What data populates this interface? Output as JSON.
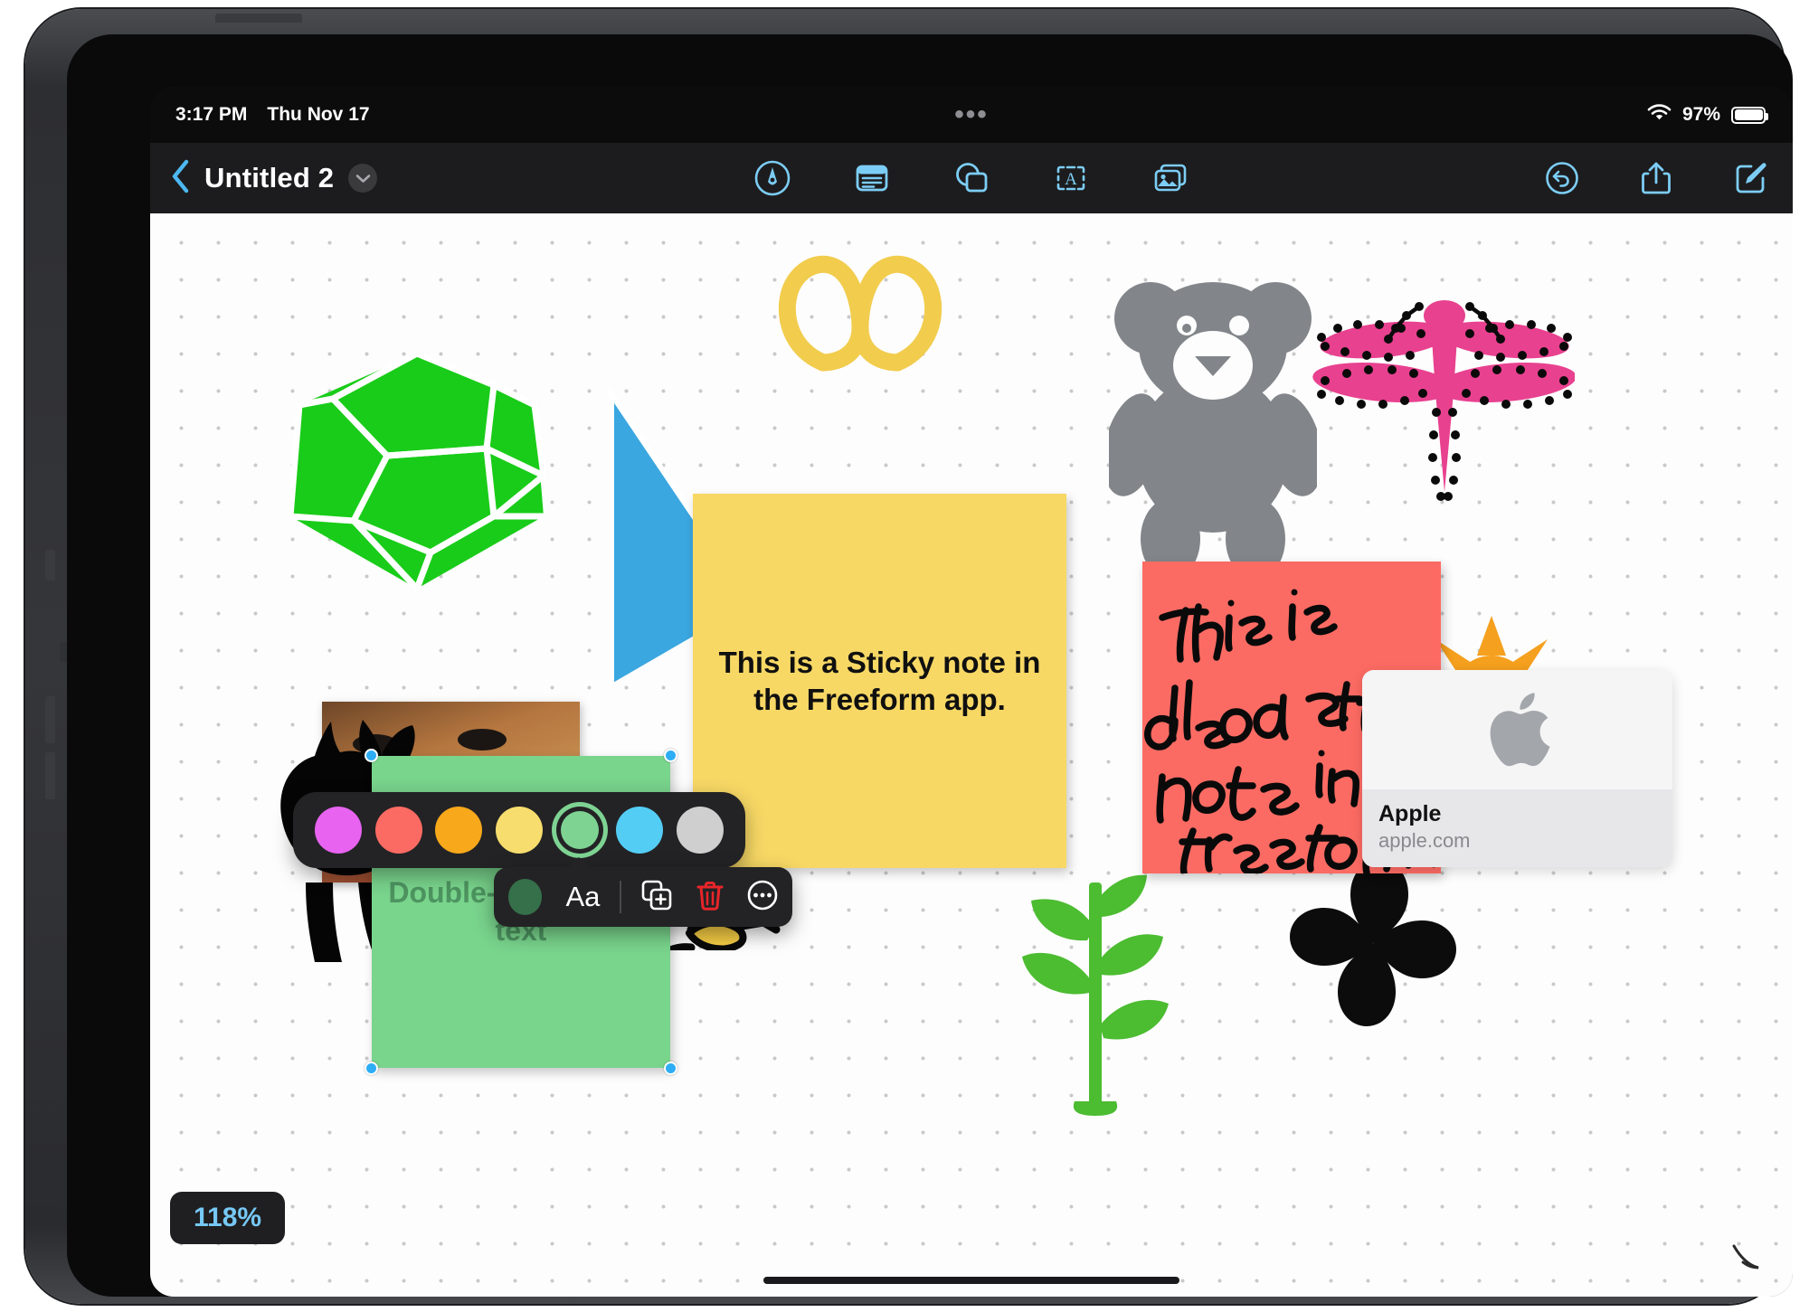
{
  "status_bar": {
    "time": "3:17 PM",
    "date": "Thu Nov 17",
    "center_dots": "•••",
    "wifi_icon": "wifi-icon",
    "battery_percent": "97%",
    "battery_icon": "battery-full-icon"
  },
  "toolbar": {
    "back_icon": "chevron-left-icon",
    "title": "Untitled 2",
    "title_chevron_icon": "chevron-down-icon",
    "center_tools": [
      {
        "name": "markup-pen-tool",
        "icon": "pen-in-circle-icon",
        "label": "Markup"
      },
      {
        "name": "sticky-note-tool",
        "icon": "sticky-note-icon",
        "label": "Sticky Note"
      },
      {
        "name": "shapes-tool",
        "icon": "shapes-icon",
        "label": "Shapes"
      },
      {
        "name": "text-box-tool",
        "icon": "text-box-icon",
        "label": "Text Box"
      },
      {
        "name": "media-tool",
        "icon": "photos-icon",
        "label": "Media"
      }
    ],
    "right_tools": [
      {
        "name": "undo-button",
        "icon": "undo-arrow-icon",
        "label": "Undo"
      },
      {
        "name": "share-button",
        "icon": "share-icon",
        "label": "Share"
      },
      {
        "name": "compose-button",
        "icon": "compose-icon",
        "label": "New Board"
      }
    ],
    "accent_color": "#7ccdf5"
  },
  "canvas": {
    "zoom_level": "118%",
    "background_color": "#fdfdfd",
    "dot_color": "#c9c9c9",
    "notes": [
      {
        "id": "note-yellow",
        "color": "#f7d865",
        "text": "This is a Sticky note in the Freeform app.",
        "selected": false
      },
      {
        "id": "note-red",
        "color": "#fc6b63",
        "handwriting": "This is also a sticky note in the freeform app.",
        "selected": false
      },
      {
        "id": "note-green",
        "color": "#79d48c",
        "placeholder": "Double-tap to enter text",
        "text_color": "#4d9460",
        "selected": true
      }
    ],
    "link_preview": {
      "logo_icon": "apple-logo-icon",
      "title": "Apple",
      "domain": "apple.com"
    },
    "shapes": [
      {
        "name": "pretzel-shape",
        "color": "#f2cc4d"
      },
      {
        "name": "teddy-bear-shape",
        "color": "#82868a"
      },
      {
        "name": "dragonfly-shape",
        "color": "#e8418f"
      },
      {
        "name": "dodecahedron-shape",
        "color": "#19cc19"
      },
      {
        "name": "sun-shape",
        "color": "#f5a01e"
      },
      {
        "name": "cat-shape",
        "color": "#000000"
      },
      {
        "name": "snake-shape",
        "color": "#f5cc44"
      },
      {
        "name": "plant-shape",
        "color": "#4cbc31"
      },
      {
        "name": "clover-shape",
        "color": "#0c0c0c"
      },
      {
        "name": "triangle-shape",
        "color": "#3ba7e0"
      }
    ]
  },
  "color_palette": {
    "swatches": [
      {
        "name": "swatch-violet",
        "color": "#e763f0",
        "selected": false
      },
      {
        "name": "swatch-red",
        "color": "#fc6b63",
        "selected": false
      },
      {
        "name": "swatch-orange",
        "color": "#f7a81b",
        "selected": false
      },
      {
        "name": "swatch-yellow",
        "color": "#f7dd6e",
        "selected": false
      },
      {
        "name": "swatch-green",
        "color": "#7ed393",
        "selected": true
      },
      {
        "name": "swatch-blue",
        "color": "#54cdf5",
        "selected": false
      },
      {
        "name": "swatch-gray",
        "color": "#cfcfcf",
        "selected": false
      }
    ]
  },
  "object_menu": {
    "color_swatch": "#35704a",
    "text_format_label": "Aa",
    "items": [
      {
        "name": "menu-color-swatch",
        "icon": "color-dot-icon"
      },
      {
        "name": "menu-text-format",
        "icon": "aa-text-icon"
      },
      {
        "name": "menu-duplicate",
        "icon": "duplicate-icon"
      },
      {
        "name": "menu-delete",
        "icon": "trash-icon",
        "color": "#e8252a"
      },
      {
        "name": "menu-more",
        "icon": "ellipsis-circle-icon"
      }
    ]
  }
}
